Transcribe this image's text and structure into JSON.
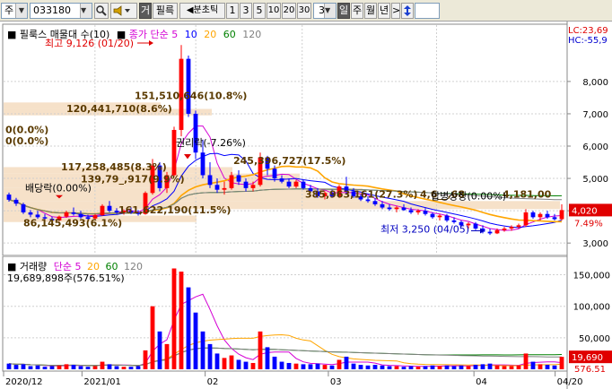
{
  "toolbar": {
    "market_label": "주",
    "stock_code": "033180",
    "search_icon": "magnifier-icon",
    "sound_icon": "speaker-icon",
    "trade_label": "거",
    "filter_label": "필륵",
    "period_type": "분초틱",
    "periods": [
      "1",
      "3",
      "5",
      "10",
      "20",
      "30"
    ],
    "period_value": "3",
    "period_unit_day": "일",
    "period_unit_week": "주",
    "period_unit_month": "월",
    "period_unit_year": "년",
    "next_arrow": ">",
    "updown_icon": "up-down-arrow-icon"
  },
  "price_pane": {
    "legend_title": "필룩스 매물대 수(10)",
    "legend_ma_label": "종가 단순",
    "legend_ma_periods": [
      "5",
      "10",
      "20",
      "60",
      "120"
    ],
    "legend_ma_colors": [
      "#d400d4",
      "#0000ff",
      "#ffa500",
      "#008000",
      "#808080"
    ],
    "lc_label": "LC:23,69",
    "hc_label": "HC:-55,9",
    "y_ticks": [
      "8,000",
      "7,000",
      "6,000",
      "5,000",
      "4,000",
      "3,000"
    ],
    "current_price": "4,020",
    "current_change": "7.49%",
    "high_label": "최고 9,126 (01/20)",
    "low_label": "최저 3,250 (04/05)",
    "dividend_label": "배당락(0.00%)",
    "rights_label": "권리락(-7.26%)",
    "volume_profile_labels": [
      "151,510,646(10.8%)",
      "120,441,710(8.6%)",
      "0(0.0%)",
      "0(0.0%)",
      "117,258,485(8.3%)",
      "139,79_,917(9.9%)",
      "245,396,727(17.5%)",
      "161,622,190(11.5%)",
      "86,145,493(6.1%)",
      "385,963,161(27.3%)",
      "4,6__,68",
      "4,181,00"
    ],
    "merge_label": "합병상장(0.00%)"
  },
  "volume_pane": {
    "legend_title": "거래량",
    "legend_ma_label": "단순",
    "legend_ma_periods": [
      "5",
      "20",
      "60",
      "120"
    ],
    "legend_ma_colors": [
      "#d400d4",
      "#ffa500",
      "#008000",
      "#808080"
    ],
    "info_label": "19,689,898주(576.51%)",
    "y_ticks": [
      "150,000",
      "100,000",
      "50,000"
    ],
    "current_volume": "19,690",
    "current_change": "576.51"
  },
  "x_axis": {
    "labels": [
      "2020/12",
      "2021/01",
      "02",
      "03",
      "04",
      "04/20"
    ]
  },
  "chart_data": {
    "type": "candlestick",
    "title": "필룩스",
    "ylim": [
      2700,
      9300
    ],
    "volume_ylim": [
      0,
      165000
    ],
    "colors": {
      "up": "#ff0000",
      "down": "#0000ff"
    },
    "x": [
      "2020/12",
      "2021/01",
      "02",
      "03",
      "04",
      "04/20"
    ],
    "candles": [
      {
        "o": 4500,
        "h": 4560,
        "l": 4280,
        "c": 4340,
        "v": 9000
      },
      {
        "o": 4340,
        "h": 4400,
        "l": 4150,
        "c": 4220,
        "v": 7000
      },
      {
        "o": 4200,
        "h": 4250,
        "l": 3900,
        "c": 3950,
        "v": 8000
      },
      {
        "o": 3950,
        "h": 4020,
        "l": 3800,
        "c": 3880,
        "v": 5000
      },
      {
        "o": 3880,
        "h": 4000,
        "l": 3750,
        "c": 3800,
        "v": 6000
      },
      {
        "o": 3800,
        "h": 3900,
        "l": 3700,
        "c": 3760,
        "v": 4000
      },
      {
        "o": 3750,
        "h": 3820,
        "l": 3650,
        "c": 3700,
        "v": 5000
      },
      {
        "o": 3700,
        "h": 3850,
        "l": 3680,
        "c": 3820,
        "v": 6000
      },
      {
        "o": 3820,
        "h": 4000,
        "l": 3780,
        "c": 3950,
        "v": 8000
      },
      {
        "o": 3950,
        "h": 4100,
        "l": 3850,
        "c": 3900,
        "v": 7000
      },
      {
        "o": 3900,
        "h": 4000,
        "l": 3750,
        "c": 3800,
        "v": 5000
      },
      {
        "o": 3800,
        "h": 3880,
        "l": 3700,
        "c": 3750,
        "v": 4000
      },
      {
        "o": 3760,
        "h": 3900,
        "l": 3720,
        "c": 3860,
        "v": 5000
      },
      {
        "o": 3860,
        "h": 4200,
        "l": 3840,
        "c": 4150,
        "v": 12000
      },
      {
        "o": 4150,
        "h": 4300,
        "l": 3950,
        "c": 4000,
        "v": 8000
      },
      {
        "o": 4000,
        "h": 4080,
        "l": 3900,
        "c": 3950,
        "v": 5000
      },
      {
        "o": 3950,
        "h": 4050,
        "l": 3880,
        "c": 4000,
        "v": 4000
      },
      {
        "o": 4000,
        "h": 4100,
        "l": 3900,
        "c": 3940,
        "v": 4000
      },
      {
        "o": 3940,
        "h": 4020,
        "l": 3850,
        "c": 3900,
        "v": 5000
      },
      {
        "o": 3900,
        "h": 4600,
        "l": 3880,
        "c": 4550,
        "v": 30000
      },
      {
        "o": 4550,
        "h": 5600,
        "l": 4500,
        "c": 5400,
        "v": 100000
      },
      {
        "o": 5400,
        "h": 5500,
        "l": 4600,
        "c": 4700,
        "v": 60000
      },
      {
        "o": 4700,
        "h": 5200,
        "l": 4550,
        "c": 5100,
        "v": 40000
      },
      {
        "o": 5100,
        "h": 6600,
        "l": 5050,
        "c": 6500,
        "v": 160000
      },
      {
        "o": 6500,
        "h": 9126,
        "l": 6300,
        "c": 8700,
        "v": 155000
      },
      {
        "o": 8700,
        "h": 8800,
        "l": 6900,
        "c": 7000,
        "v": 130000
      },
      {
        "o": 7000,
        "h": 7100,
        "l": 5600,
        "c": 5800,
        "v": 90000
      },
      {
        "o": 5800,
        "h": 6200,
        "l": 5000,
        "c": 5100,
        "v": 60000
      },
      {
        "o": 5100,
        "h": 5500,
        "l": 4700,
        "c": 4800,
        "v": 40000
      },
      {
        "o": 4800,
        "h": 5000,
        "l": 4550,
        "c": 4650,
        "v": 25000
      },
      {
        "o": 4650,
        "h": 4900,
        "l": 4500,
        "c": 4700,
        "v": 18000
      },
      {
        "o": 4700,
        "h": 5200,
        "l": 4650,
        "c": 5100,
        "v": 22000
      },
      {
        "o": 5100,
        "h": 5250,
        "l": 4800,
        "c": 4900,
        "v": 15000
      },
      {
        "o": 4900,
        "h": 5000,
        "l": 4600,
        "c": 4700,
        "v": 12000
      },
      {
        "o": 4700,
        "h": 4900,
        "l": 4600,
        "c": 4800,
        "v": 10000
      },
      {
        "o": 4800,
        "h": 5800,
        "l": 4750,
        "c": 5650,
        "v": 60000
      },
      {
        "o": 5650,
        "h": 5700,
        "l": 5100,
        "c": 5300,
        "v": 35000
      },
      {
        "o": 5300,
        "h": 5400,
        "l": 4900,
        "c": 5000,
        "v": 20000
      },
      {
        "o": 5000,
        "h": 5100,
        "l": 4850,
        "c": 4900,
        "v": 12000
      },
      {
        "o": 4900,
        "h": 5000,
        "l": 4700,
        "c": 4750,
        "v": 10000
      },
      {
        "o": 4750,
        "h": 4950,
        "l": 4700,
        "c": 4900,
        "v": 9000
      },
      {
        "o": 4900,
        "h": 4950,
        "l": 4650,
        "c": 4700,
        "v": 8000
      },
      {
        "o": 4700,
        "h": 4800,
        "l": 4550,
        "c": 4600,
        "v": 8000
      },
      {
        "o": 4600,
        "h": 4700,
        "l": 4400,
        "c": 4450,
        "v": 9000
      },
      {
        "o": 4450,
        "h": 4600,
        "l": 4350,
        "c": 4550,
        "v": 7000
      },
      {
        "o": 4550,
        "h": 4650,
        "l": 4400,
        "c": 4450,
        "v": 6000
      },
      {
        "o": 4450,
        "h": 4800,
        "l": 4400,
        "c": 4750,
        "v": 15000
      },
      {
        "o": 4750,
        "h": 5050,
        "l": 4500,
        "c": 4600,
        "v": 20000
      },
      {
        "o": 4600,
        "h": 4700,
        "l": 4400,
        "c": 4450,
        "v": 9000
      },
      {
        "o": 4450,
        "h": 4500,
        "l": 4300,
        "c": 4350,
        "v": 7000
      },
      {
        "o": 4350,
        "h": 4450,
        "l": 4250,
        "c": 4300,
        "v": 6000
      },
      {
        "o": 4300,
        "h": 4400,
        "l": 4150,
        "c": 4200,
        "v": 7000
      },
      {
        "o": 4200,
        "h": 4300,
        "l": 4050,
        "c": 4100,
        "v": 6000
      },
      {
        "o": 4100,
        "h": 4200,
        "l": 4000,
        "c": 4050,
        "v": 5000
      },
      {
        "o": 4050,
        "h": 4150,
        "l": 3950,
        "c": 4100,
        "v": 5000
      },
      {
        "o": 4100,
        "h": 4200,
        "l": 4000,
        "c": 4020,
        "v": 4000
      },
      {
        "o": 4020,
        "h": 4100,
        "l": 3900,
        "c": 3950,
        "v": 5000
      },
      {
        "o": 3950,
        "h": 4050,
        "l": 3880,
        "c": 4000,
        "v": 4000
      },
      {
        "o": 4000,
        "h": 4080,
        "l": 3850,
        "c": 3900,
        "v": 5000
      },
      {
        "o": 3900,
        "h": 3950,
        "l": 3750,
        "c": 3800,
        "v": 6000
      },
      {
        "o": 3800,
        "h": 3900,
        "l": 3700,
        "c": 3850,
        "v": 5000
      },
      {
        "o": 3850,
        "h": 3900,
        "l": 3650,
        "c": 3700,
        "v": 6000
      },
      {
        "o": 3700,
        "h": 3800,
        "l": 3600,
        "c": 3650,
        "v": 5000
      },
      {
        "o": 3650,
        "h": 3700,
        "l": 3500,
        "c": 3550,
        "v": 6000
      },
      {
        "o": 3550,
        "h": 3650,
        "l": 3450,
        "c": 3600,
        "v": 5000
      },
      {
        "o": 3600,
        "h": 3650,
        "l": 3400,
        "c": 3450,
        "v": 7000
      },
      {
        "o": 3450,
        "h": 3550,
        "l": 3300,
        "c": 3350,
        "v": 8000
      },
      {
        "o": 3350,
        "h": 3450,
        "l": 3250,
        "c": 3300,
        "v": 9000
      },
      {
        "o": 3300,
        "h": 3450,
        "l": 3280,
        "c": 3400,
        "v": 6000
      },
      {
        "o": 3400,
        "h": 3500,
        "l": 3350,
        "c": 3450,
        "v": 5000
      },
      {
        "o": 3450,
        "h": 3550,
        "l": 3380,
        "c": 3500,
        "v": 5000
      },
      {
        "o": 3500,
        "h": 3600,
        "l": 3450,
        "c": 3550,
        "v": 6000
      },
      {
        "o": 3550,
        "h": 4050,
        "l": 3500,
        "c": 3950,
        "v": 25000
      },
      {
        "o": 3950,
        "h": 4000,
        "l": 3750,
        "c": 3800,
        "v": 12000
      },
      {
        "o": 3800,
        "h": 3950,
        "l": 3700,
        "c": 3900,
        "v": 8000
      },
      {
        "o": 3900,
        "h": 4000,
        "l": 3750,
        "c": 3800,
        "v": 7000
      },
      {
        "o": 3800,
        "h": 3900,
        "l": 3700,
        "c": 3740,
        "v": 6000
      },
      {
        "o": 3740,
        "h": 4200,
        "l": 3700,
        "c": 4020,
        "v": 19690
      }
    ]
  }
}
